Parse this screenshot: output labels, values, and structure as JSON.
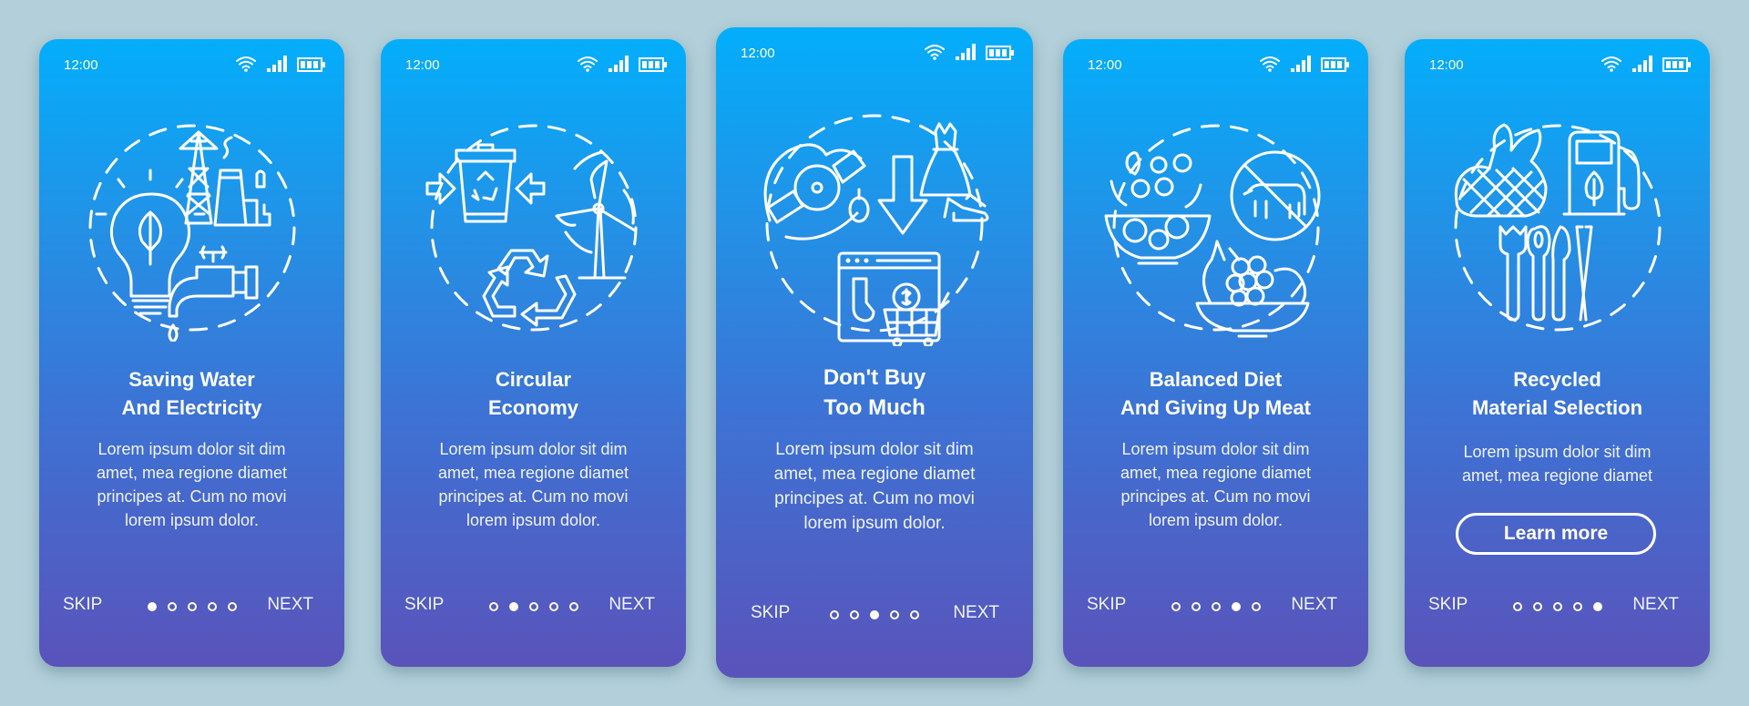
{
  "status_bar": {
    "time": "12:00",
    "icons": [
      "wifi-icon",
      "signal-icon",
      "battery-icon"
    ]
  },
  "screens": [
    {
      "title": "Saving Water\nAnd Electricity",
      "body": "Lorem ipsum dolor sit dim\namet, mea regione diamet\nprincipes at. Cum no movi\nlorem ipsum dolor.",
      "illustration": [
        "lightbulb-leaf-icon",
        "power-tower-icon",
        "factory-icon",
        "water-tap-icon",
        "water-drop-icon"
      ],
      "active_page": 1
    },
    {
      "title": "Circular\nEconomy",
      "body": "Lorem ipsum dolor sit dim\namet, mea regione diamet\nprincipes at. Cum no movi\nlorem ipsum dolor.",
      "illustration": [
        "recycle-bin-icon",
        "wind-turbine-icon",
        "recycle-arrows-icon"
      ],
      "active_page": 2
    },
    {
      "title": "Don't Buy\nToo Much",
      "body": "Lorem ipsum dolor sit dim\namet, mea regione diamet\nprincipes at. Cum no movi\nlorem ipsum dolor.",
      "illustration": [
        "watch-icon",
        "pendant-icon",
        "down-arrow-icon",
        "dress-icon",
        "shoes-icon",
        "online-shop-icon",
        "shopping-cart-icon"
      ],
      "active_page": 3
    },
    {
      "title": "Balanced Diet\nAnd Giving Up Meat",
      "body": "Lorem ipsum dolor sit dim\namet, mea regione diamet\nprincipes at. Cum no movi\nlorem ipsum dolor.",
      "illustration": [
        "salad-bowl-icon",
        "no-meat-icon",
        "fruit-bowl-icon"
      ],
      "active_page": 4
    },
    {
      "title": "Recycled\nMaterial Selection",
      "body": "Lorem ipsum dolor sit dim\namet, mea regione diamet",
      "illustration": [
        "mesh-bag-icon",
        "eco-fuel-pump-icon",
        "wooden-cutlery-icon"
      ],
      "button_label": "Learn more",
      "active_page": 5
    }
  ],
  "nav": {
    "skip_label": "SKIP",
    "next_label": "NEXT",
    "page_count": 5
  },
  "colors": {
    "background": "#b3d0da",
    "gradient_top": "#03aefb",
    "gradient_bottom": "#5a53ba",
    "foreground": "#ffffff"
  }
}
